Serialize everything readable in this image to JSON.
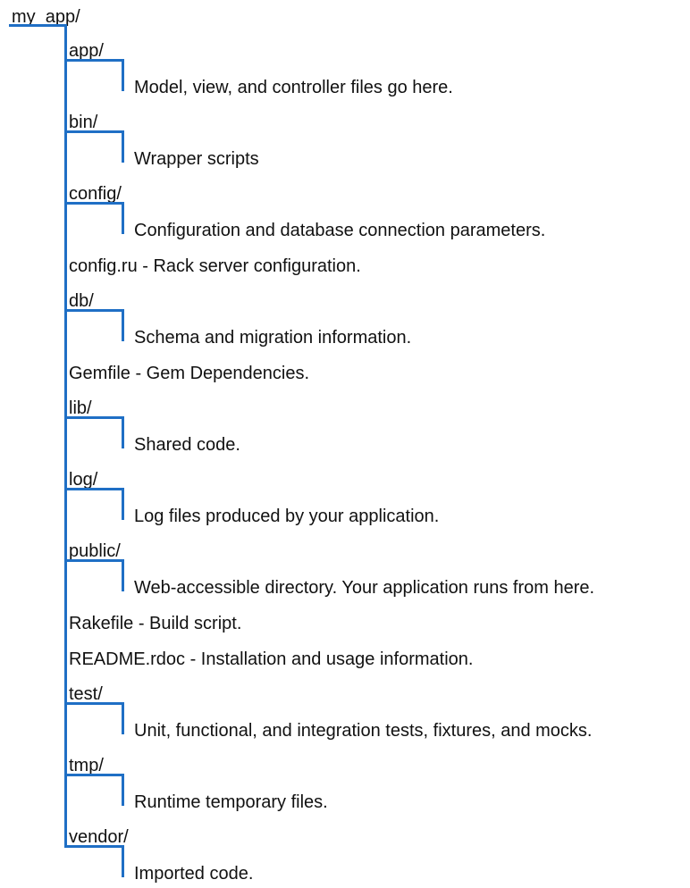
{
  "colors": {
    "connector": "#1f6fc5",
    "text": "#111111",
    "background": "#ffffff"
  },
  "root": {
    "label": "my_app/"
  },
  "entries": [
    {
      "kind": "folder",
      "name": "app/",
      "description": "Model, view, and controller files go here."
    },
    {
      "kind": "folder",
      "name": "bin/",
      "description": "Wrapper scripts"
    },
    {
      "kind": "folder",
      "name": "config/",
      "description": "Configuration and database connection parameters."
    },
    {
      "kind": "file",
      "text": "config.ru - Rack server configuration."
    },
    {
      "kind": "folder",
      "name": "db/",
      "description": "Schema and migration information."
    },
    {
      "kind": "file",
      "text": "Gemfile - Gem Dependencies."
    },
    {
      "kind": "folder",
      "name": "lib/",
      "description": "Shared code."
    },
    {
      "kind": "folder",
      "name": "log/",
      "description": "Log files produced by your application."
    },
    {
      "kind": "folder",
      "name": "public/",
      "description": "Web-accessible directory. Your application runs from here."
    },
    {
      "kind": "file",
      "text": "Rakefile - Build script."
    },
    {
      "kind": "file",
      "text": "README.rdoc - Installation and usage information."
    },
    {
      "kind": "folder",
      "name": "test/",
      "description": "Unit, functional, and integration tests, fixtures, and mocks."
    },
    {
      "kind": "folder",
      "name": "tmp/",
      "description": "Runtime temporary files."
    },
    {
      "kind": "folder",
      "name": "vendor/",
      "description": "Imported code."
    }
  ]
}
